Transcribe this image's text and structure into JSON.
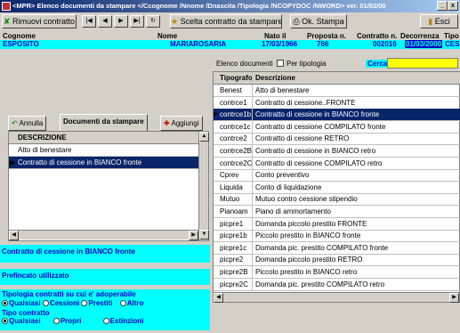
{
  "window": {
    "title": "<MPR> Elenco documenti da stampare </Ccognome /Nnome /Dnascita /Tipologia /NCOPYDOC /NWORD> ver. 01/02/00"
  },
  "toolbar": {
    "remove": "Rimuovi contratto",
    "nav": [
      "|◀",
      "◀",
      "▶",
      "▶|",
      "↻"
    ],
    "choose": "Scelta contratto da stampare",
    "print": "Ok. Stampa",
    "exit": "Esci"
  },
  "header": {
    "labels": {
      "cognome": "Cognome",
      "nome": "Nome",
      "nato": "Nato il",
      "proposta": "Proposta n.",
      "contratto": "Contratto n.",
      "decorrenza": "Decorrenza",
      "tipo": "Tipo"
    },
    "values": {
      "cognome": "ESPOSITO",
      "nome": "MARIAROSARIA",
      "nato": "17/03/1966",
      "proposta": "766",
      "contratto": "002016",
      "decorrenza": "01/03/2000",
      "tipo": "CES"
    }
  },
  "elenco": {
    "label": "Elenco documenti",
    "checkbox": "Per tipologia",
    "search_label": "Cerca",
    "search_value": ""
  },
  "tabs": {
    "annulla": "Annulla",
    "documenti": "Documenti da stampare",
    "aggiungi": "Aggiungi"
  },
  "left_grid": {
    "header": "DESCRIZIONE",
    "rows": [
      "Atto di benestare",
      "Contratto di cessione in BIANCO fronte"
    ]
  },
  "info": {
    "selected": "Contratto di cessione in BIANCO fronte",
    "prefincato": "Prefincato utilizzato"
  },
  "options": {
    "tipologia_label": "Tipologia contratti su cui e' adoperabile",
    "tipologia": [
      "Qualsiasi",
      "Cessioni",
      "Prestiti",
      "Altro"
    ],
    "tipo_label": "Tipo contratto",
    "tipo": [
      "Qualsiasi",
      "Propri",
      "Estinzioni"
    ]
  },
  "right_grid": {
    "headers": [
      "Tipografo",
      "Descrizione"
    ],
    "rows": [
      [
        "Benest",
        "Atto di benestare"
      ],
      [
        "contrce1",
        "Contratto di cessione..FRONTE"
      ],
      [
        "contrce1b",
        "Contratto di cessione in BIANCO fronte"
      ],
      [
        "contrce1c",
        "Contratto di cessione COMPILATO fronte"
      ],
      [
        "contrce2",
        "Contratto di cessione RETRO"
      ],
      [
        "contrce2B",
        "Contratto di cessione in BIANCO retro"
      ],
      [
        "contrce2C",
        "Contratto di cessione COMPILATO retro"
      ],
      [
        "Cprev",
        "Conto preventivo"
      ],
      [
        "Liquida",
        "Conto di liquidazione"
      ],
      [
        "Mutuo",
        "Mutuo contro cessione stipendio"
      ],
      [
        "Pianoam",
        "Piano di ammortamento"
      ],
      [
        "picpre1",
        "Domanda piccolo prestito FRONTE"
      ],
      [
        "picpre1b",
        "Piccolo prestito in BIANCO fronte"
      ],
      [
        "picpre1c",
        "Domanda pic. prestito COMPILATO fronte"
      ],
      [
        "picpre2",
        "Domanda piccolo prestito RETRO"
      ],
      [
        "picpre2B",
        "Piccolo prestito in BIANCO retro"
      ],
      [
        "picpre2C",
        "Domanda pic. prestito COMPILATO retro"
      ]
    ],
    "selected_index": 2
  },
  "colors": {
    "cyan": "#00ffff",
    "selection": "#0a246a",
    "title": "#0a246a"
  }
}
